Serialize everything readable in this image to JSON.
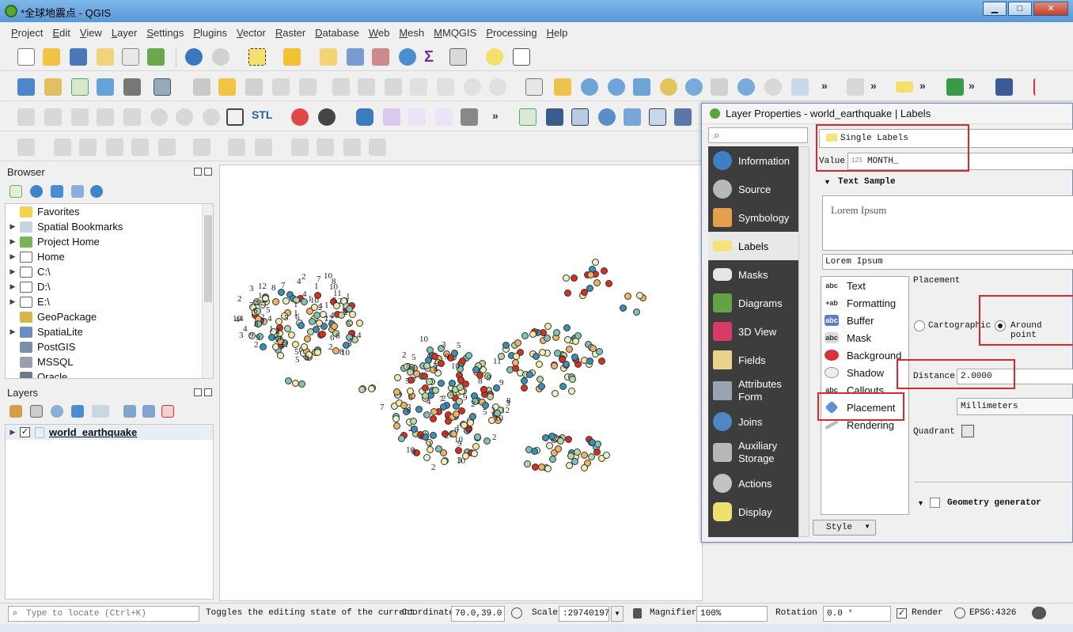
{
  "window": {
    "title": "*全球地震点 - QGIS",
    "min": "▁",
    "max": "□",
    "close": "✕"
  },
  "menu": [
    "Project",
    "Edit",
    "View",
    "Layer",
    "Settings",
    "Plugins",
    "Vector",
    "Raster",
    "Database",
    "Web",
    "Mesh",
    "MMQGIS",
    "Processing",
    "Help"
  ],
  "toolbar_text": {
    "more": "»",
    "stl": "STL"
  },
  "browser": {
    "title": "Browser",
    "items": [
      {
        "label": "Favorites",
        "expand": ""
      },
      {
        "label": "Spatial Bookmarks",
        "expand": "▶"
      },
      {
        "label": "Project Home",
        "expand": "▶"
      },
      {
        "label": "Home",
        "expand": "▶"
      },
      {
        "label": "C:\\",
        "expand": "▶"
      },
      {
        "label": "D:\\",
        "expand": "▶"
      },
      {
        "label": "E:\\",
        "expand": "▶"
      },
      {
        "label": "GeoPackage",
        "expand": ""
      },
      {
        "label": "SpatiaLite",
        "expand": "▶"
      },
      {
        "label": "PostGIS",
        "expand": ""
      },
      {
        "label": "MSSQL",
        "expand": ""
      },
      {
        "label": "Oracle",
        "expand": ""
      }
    ]
  },
  "layers": {
    "title": "Layers",
    "layer_name": "world_earthquake",
    "expand": "▶",
    "checked": "✓"
  },
  "map": {
    "labels": [
      "9",
      "5",
      "5",
      "1",
      "2",
      "8",
      "5",
      "9",
      "2",
      "6",
      "4",
      "3",
      "8",
      "9",
      "6",
      "6",
      "3",
      "4",
      "5",
      "8",
      "2",
      "4",
      "6",
      "4",
      "4",
      "5",
      "3",
      "8",
      "1",
      "4",
      "4",
      "2",
      "2",
      "4",
      "8",
      "11",
      "10",
      "1",
      "1",
      "7",
      "1",
      "1",
      "2",
      "2",
      "10",
      "7",
      "7",
      "12",
      "11",
      "2",
      "1",
      "5",
      "2",
      "12",
      "10",
      "2",
      "10",
      "12",
      "10",
      "7",
      "7",
      "7",
      "1",
      "5",
      "7",
      "7",
      "4",
      "4",
      "5",
      "10",
      "6",
      "5",
      "7",
      "11",
      "10",
      "9",
      "6",
      "7",
      "10",
      "12",
      "4",
      "5",
      "7",
      "2",
      "3",
      "4",
      "3",
      "5",
      "8",
      "10",
      "10",
      "8",
      "9",
      "5",
      "3",
      "9",
      "3",
      "2",
      "9",
      "3",
      "3",
      "2",
      "8",
      "7",
      "5",
      "2",
      "2",
      "2",
      "8",
      "3",
      "10",
      "4",
      "1",
      "2",
      "9",
      "8"
    ]
  },
  "dialog": {
    "title": "Layer Properties - world_earthquake | Labels",
    "nav": [
      "Information",
      "Source",
      "Symbology",
      "Labels",
      "Masks",
      "Diagrams",
      "3D View",
      "Fields",
      "Attributes Form",
      "Joins",
      "Auxiliary Storage",
      "Actions",
      "Display"
    ],
    "label_mode": "Single Labels",
    "value_label": "Value",
    "value_type": "123",
    "value_field": "MONTH_",
    "text_sample_title": "Text Sample",
    "sample_preview": "Lorem Ipsum",
    "sample_input": "Lorem Ipsum",
    "subtabs": [
      "Text",
      "Formatting",
      "Buffer",
      "Mask",
      "Background",
      "Shadow",
      "Callouts",
      "Placement",
      "Rendering"
    ],
    "placement_title": "Placement",
    "opt_cartographic": "Cartographic",
    "opt_around_point": "Around point",
    "distance_label": "Distance",
    "distance_value": "2.0000",
    "units": "Millimeters",
    "quadrant_label": "Quadrant",
    "geometry_generator": "Geometry generator",
    "style_button": "Style"
  },
  "statusbar": {
    "locate_placeholder": "Type to locate (Ctrl+K)",
    "message": "Toggles the editing state of the current",
    "coordinate_label": "Coordinate",
    "coordinate_value": "70.0,39.0",
    "scale_label": "Scale",
    "scale_value": ":29740197",
    "magnifier_label": "Magnifier",
    "magnifier_value": "100%",
    "rotation_label": "Rotation",
    "rotation_value": "0.0 °",
    "render_label": "Render",
    "crs": "EPSG:4326"
  },
  "colors": {
    "accent": "#5a98d6",
    "highlight_red": "#e0262d",
    "nav_bg": "#3d3d3d"
  }
}
